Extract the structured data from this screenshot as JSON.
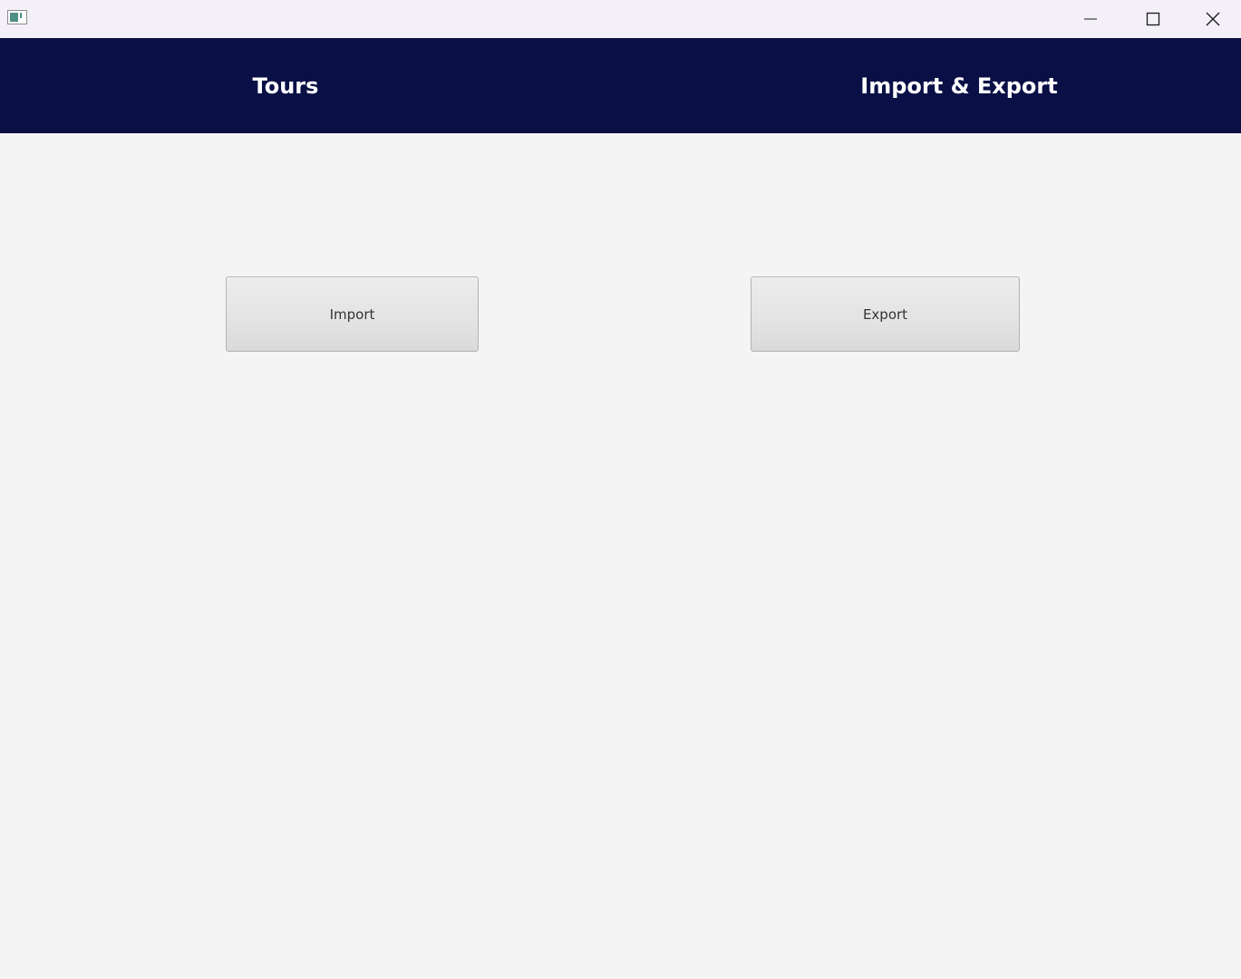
{
  "window": {
    "titlebar_color": "#f3f0f7",
    "icons": {
      "app": "app-icon",
      "minimize": "minimize-icon",
      "maximize": "maximize-icon",
      "close": "close-icon"
    }
  },
  "navbar": {
    "background": "#0a1046",
    "tabs": [
      {
        "label": "Tours"
      },
      {
        "label": "Import & Export"
      }
    ]
  },
  "main": {
    "import_label": "Import",
    "export_label": "Export"
  }
}
